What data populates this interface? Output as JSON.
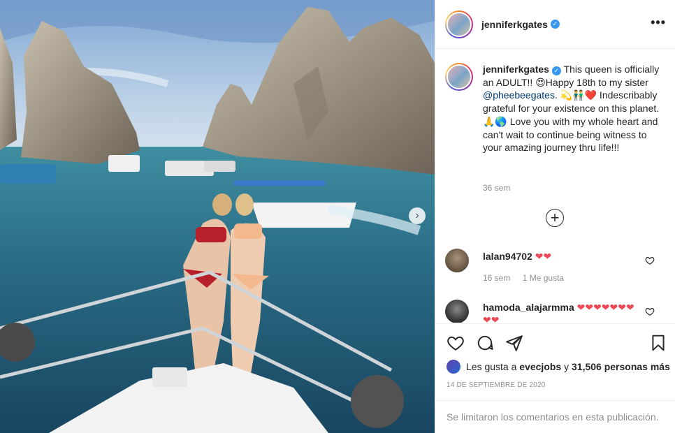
{
  "post": {
    "username": "jenniferkgates",
    "verified_mark": "✓",
    "more_icon": "more-horizontal-icon",
    "caption_line_1": "This queen is officially an ADULT!! 😍Happy 18th to my sister ",
    "caption_mention": "@pheebeegates",
    "caption_line_2": ". 💫👬❤️ Indescribably grateful for your existence on this planet. 🙏🌎 Love you with my whole heart and can't wait to continue being witness to your amazing journey thru life!!!",
    "caption_time": "36 sem",
    "load_more_symbol": "+",
    "carousel_next": "›"
  },
  "comments": [
    {
      "username": "lalan94702",
      "text": "❤❤",
      "time": "16 sem",
      "likes": "1 Me gusta",
      "avatar_color": "#6b5a48"
    },
    {
      "username": "hamoda_alajarmma",
      "text": "❤❤❤❤❤❤❤❤❤",
      "avatar_color": "#3a3a3a"
    }
  ],
  "actions": {
    "likes_prefix": "Les gusta a ",
    "likes_user": "evecjobs",
    "likes_middle": " y ",
    "likes_count": "31,506 personas más",
    "date": "14 DE SEPTIEMBRE DE 2020"
  },
  "footer": {
    "comments_closed": "Se limitaron los comentarios en esta publicación."
  },
  "colors": {
    "verified": "#3897f0",
    "heart": "#ed4956",
    "muted": "#8e8e8e",
    "mention": "#00376b"
  }
}
